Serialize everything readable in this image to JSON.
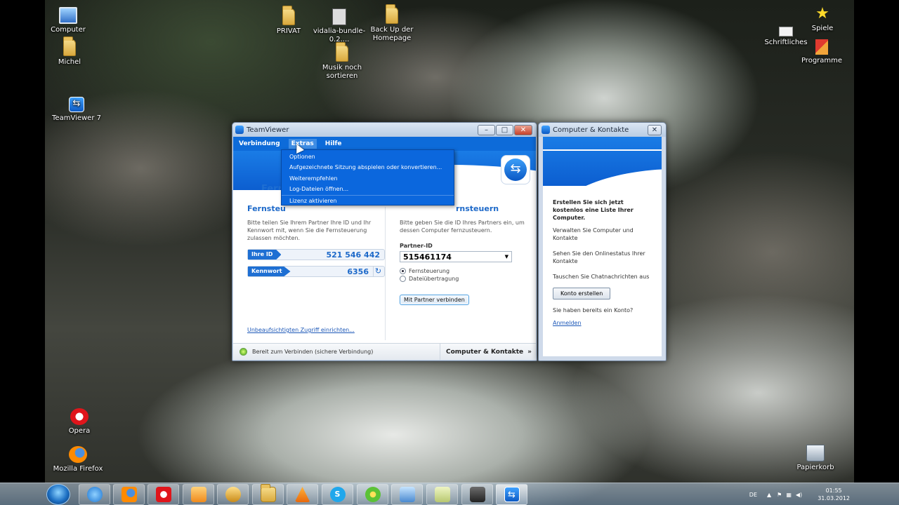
{
  "desktop": {
    "icons": {
      "computer": "Computer",
      "michel": "Michel",
      "teamviewer": "TeamViewer 7",
      "privat": "PRIVAT",
      "vidalia": "vidalia-bundle-0.2....",
      "backup": "Back Up der Homepage",
      "musik": "Musik noch sortieren",
      "spiele": "Spiele",
      "schriftliches": "Schriftliches",
      "programme": "Programme",
      "opera": "Opera",
      "firefox": "Mozilla Firefox",
      "papierkorb": "Papierkorb"
    }
  },
  "teamviewer": {
    "title": "TeamViewer",
    "menu": {
      "verbindung": "Verbindung",
      "extras": "Extras",
      "hilfe": "Hilfe"
    },
    "extras_menu": [
      "Optionen",
      "Aufgezeichnete Sitzung abspielen oder konvertieren...",
      "Weiterempfehlen",
      "Log-Dateien öffnen...",
      "Lizenz aktivieren"
    ],
    "tab_label": "Fern",
    "left": {
      "heading": "Fernsteu",
      "text": "Bitte teilen Sie Ihrem Partner Ihre ID und Ihr Kennwort mit, wenn Sie die Fernsteuerung zulassen möchten.",
      "id_label": "Ihre ID",
      "id_value": "521 546 442",
      "password_label": "Kennwort",
      "password_value": "6356",
      "unattended_link": "Unbeaufsichtigten Zugriff einrichten..."
    },
    "right": {
      "heading": "rnsteuern",
      "text": "Bitte geben Sie die ID Ihres Partners ein, um dessen Computer fernzusteuern.",
      "partner_label": "Partner-ID",
      "partner_value": "515461174",
      "radio_remote": "Fernsteuerung",
      "radio_file": "Dateiübertragung",
      "connect_button": "Mit Partner verbinden"
    },
    "status_text": "Bereit zum Verbinden (sichere Verbindung)",
    "contacts_button": "Computer & Kontakte"
  },
  "contacts": {
    "title": "Computer & Kontakte",
    "headline": "Erstellen Sie sich jetzt kostenlos eine Liste Ihrer Computer.",
    "p1": "Verwalten Sie Computer und Kontakte",
    "p2": "Sehen Sie den Onlinestatus Ihrer Kontakte",
    "p3": "Tauschen Sie Chatnachrichten aus",
    "create_button": "Konto erstellen",
    "have_account": "Sie haben bereits ein Konto?",
    "login_link": "Anmelden"
  },
  "taskbar": {
    "language": "DE",
    "time": "01:55",
    "date": "31.03.2012"
  }
}
